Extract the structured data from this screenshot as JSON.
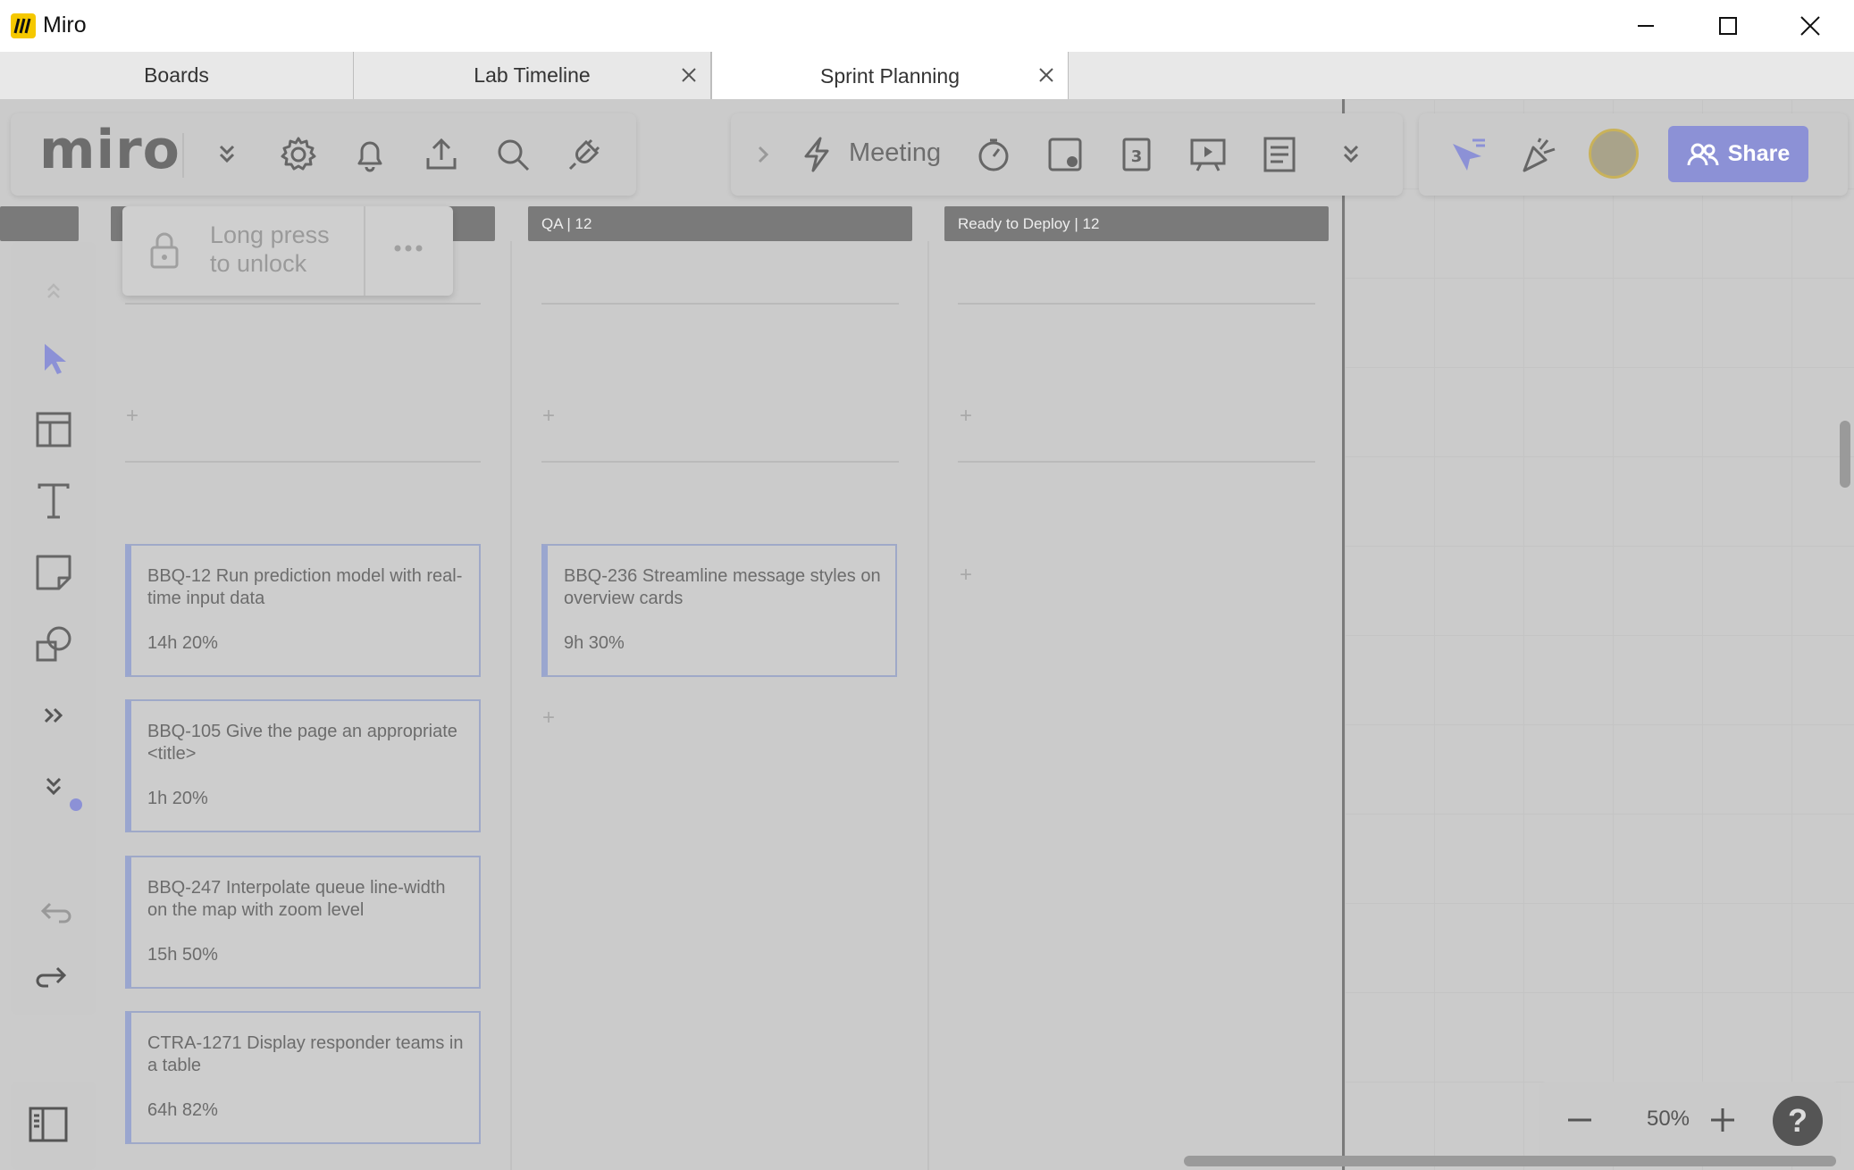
{
  "window": {
    "title": "Miro"
  },
  "tabs": [
    {
      "label": "Boards"
    },
    {
      "label": "Lab Timeline"
    },
    {
      "label": "Sprint Planning"
    }
  ],
  "toolbar": {
    "logo_text": "miro",
    "meeting_label": "Meeting",
    "share_label": "Share",
    "timer_icon": "timer-icon",
    "vote_badge": "3"
  },
  "lock_popup": {
    "text": "Long press to unlock"
  },
  "columns": [
    {
      "header": "",
      "cards": [
        {
          "title": "BBQ-12 Run prediction model with real-time input data",
          "meta": "14h 20%"
        },
        {
          "title": "BBQ-105 Give the page an appropriate <title>",
          "meta": "1h 20%"
        },
        {
          "title": "BBQ-247 Interpolate queue line-width on the map with zoom level",
          "meta": "15h 50%"
        },
        {
          "title": "CTRA-1271 Display responder teams in a table",
          "meta": "64h 82%"
        }
      ]
    },
    {
      "header": "QA  |  12",
      "cards": [
        {
          "title": "BBQ-236 Streamline message styles on overview cards",
          "meta": "9h 30%"
        }
      ]
    },
    {
      "header": "Ready to Deploy  |  12",
      "cards": []
    }
  ],
  "zoom": {
    "level": "50%"
  },
  "help_label": "?",
  "colors": {
    "accent": "#8c91d6",
    "canvas": "#cbcbcb",
    "header": "#7a7a7a"
  }
}
